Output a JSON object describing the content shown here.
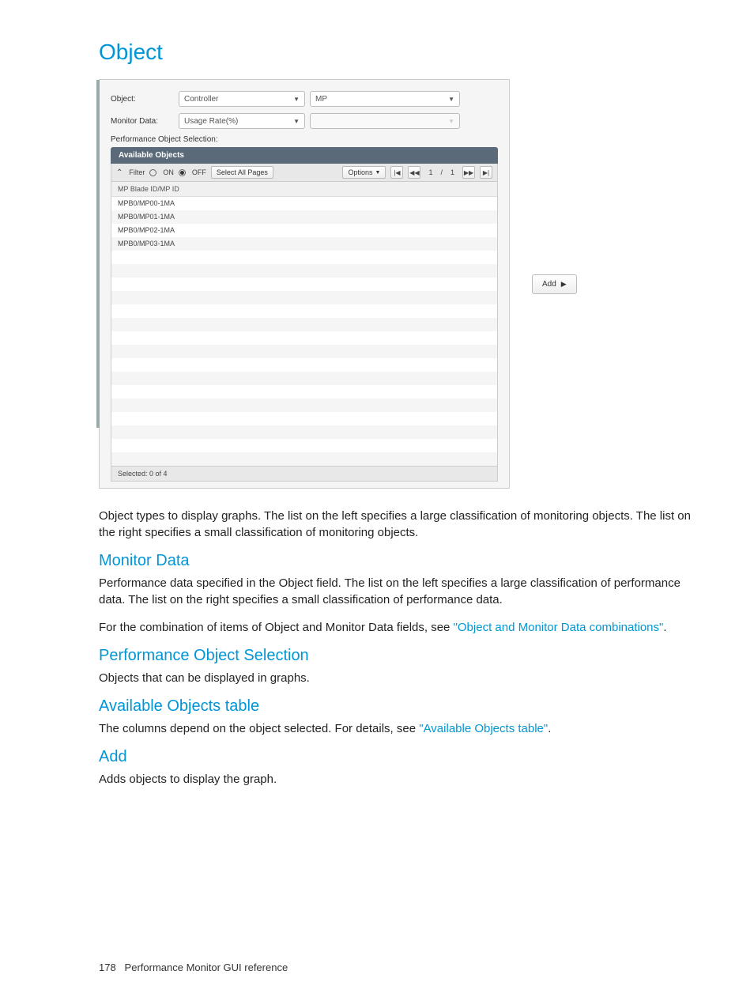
{
  "page": {
    "title": "Object",
    "footer_page": "178",
    "footer_text": "Performance Monitor GUI reference"
  },
  "panel": {
    "object_label": "Object:",
    "object_select_left": "Controller",
    "object_select_right": "MP",
    "monitor_label": "Monitor Data:",
    "monitor_select_left": "Usage Rate(%)",
    "monitor_select_right": "",
    "section_label": "Performance Object Selection:",
    "tab_title": "Available Objects",
    "toolbar": {
      "filter_label": "Filter",
      "on_label": "ON",
      "off_label": "OFF",
      "select_all": "Select All Pages",
      "options": "Options",
      "page_current": "1",
      "page_sep": "/",
      "page_total": "1"
    },
    "table_head": "MP Blade ID/MP ID",
    "rows": [
      "MPB0/MP00-1MA",
      "MPB0/MP01-1MA",
      "MPB0/MP02-1MA",
      "MPB0/MP03-1MA",
      "",
      "",
      "",
      "",
      "",
      "",
      "",
      "",
      "",
      "",
      "",
      "",
      "",
      "",
      "",
      ""
    ],
    "selected_text": "Selected:  0   of  4",
    "add_button": "Add"
  },
  "doc": {
    "object_desc": "Object types to display graphs. The list on the left specifies a large classification of monitoring objects. The list on the right specifies a small classification of monitoring objects.",
    "monitor_heading": "Monitor Data",
    "monitor_desc1": "Performance data specified in the Object field. The list on the left specifies a large classification of performance data. The list on the right specifies a small classification of performance data.",
    "monitor_desc2a": "For the combination of items of Object and Monitor Data fields, see ",
    "monitor_link": "\"Object and Monitor Data combinations\"",
    "monitor_desc2b": ".",
    "pos_heading": "Performance Object Selection",
    "pos_desc": "Objects that can be displayed in graphs.",
    "aot_heading": "Available Objects table",
    "aot_desc_a": "The columns depend on the object selected. For details, see ",
    "aot_link": "\"Available Objects table\"",
    "aot_desc_b": ".",
    "add_heading": "Add",
    "add_desc": "Adds objects to display the graph."
  }
}
